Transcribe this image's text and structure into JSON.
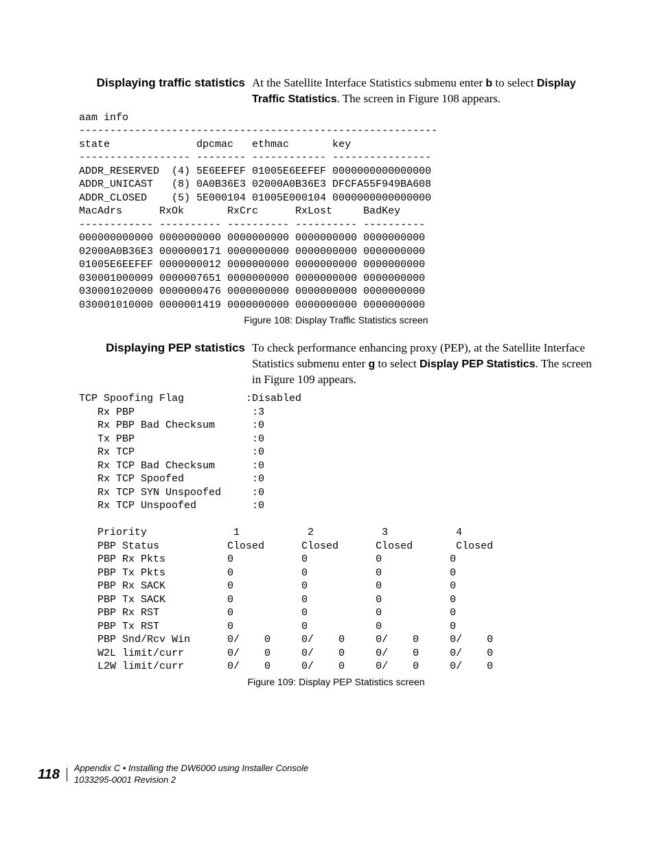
{
  "section1": {
    "heading": "Displaying traffic statistics",
    "para": "At the Satellite Interface Statistics submenu enter ",
    "key": "b",
    "para2": " to select ",
    "bold2": "Display Traffic Statistics",
    "para3": ". The screen in Figure 108 appears."
  },
  "fig108": {
    "caption": "Figure 108:  Display Traffic Statistics screen",
    "text": "aam info\n----------------------------------------------------------\nstate              dpcmac   ethmac       key\n------------------ -------- ------------ ----------------\nADDR_RESERVED  (4) 5E6EEFEF 01005E6EEFEF 0000000000000000\nADDR_UNICAST   (8) 0A0B36E3 02000A0B36E3 DFCFA55F949BA608\nADDR_CLOSED    (5) 5E000104 01005E000104 0000000000000000\nMacAdrs      RxOk       RxCrc      RxLost     BadKey\n------------ ---------- ---------- ---------- ----------\n000000000000 0000000000 0000000000 0000000000 0000000000\n02000A0B36E3 0000000171 0000000000 0000000000 0000000000\n01005E6EEFEF 0000000012 0000000000 0000000000 0000000000\n030001000009 0000007651 0000000000 0000000000 0000000000\n030001020000 0000000476 0000000000 0000000000 0000000000\n030001010000 0000001419 0000000000 0000000000 0000000000"
  },
  "section2": {
    "heading": "Displaying PEP statistics",
    "para": "To check performance enhancing proxy (PEP), at the Satellite Interface Statistics submenu enter ",
    "key": "g",
    "para2": " to select ",
    "bold2": "Display PEP Statistics",
    "para3": ". The screen in Figure 109 appears."
  },
  "fig109": {
    "caption": "Figure 109:  Display PEP Statistics screen",
    "text": "TCP Spoofing Flag          :Disabled\n   Rx PBP                   :3\n   Rx PBP Bad Checksum      :0\n   Tx PBP                   :0\n   Rx TCP                   :0\n   Rx TCP Bad Checksum      :0\n   Rx TCP Spoofed           :0\n   Rx TCP SYN Unspoofed     :0\n   Rx TCP Unspoofed         :0\n\n   Priority              1           2           3           4\n   PBP Status           Closed      Closed      Closed       Closed\n   PBP Rx Pkts          0           0           0           0\n   PBP Tx Pkts          0           0           0           0\n   PBP Rx SACK          0           0           0           0\n   PBP Tx SACK          0           0           0           0\n   PBP Rx RST           0           0           0           0\n   PBP Tx RST           0           0           0           0\n   PBP Snd/Rcv Win      0/    0     0/    0     0/    0     0/    0\n   W2L limit/curr       0/    0     0/    0     0/    0     0/    0\n   L2W limit/curr       0/    0     0/    0     0/    0     0/    0"
  },
  "footer": {
    "page": "118",
    "line1": "Appendix C • Installing the DW6000 using Installer Console",
    "line2": "1033295-0001  Revision 2"
  }
}
